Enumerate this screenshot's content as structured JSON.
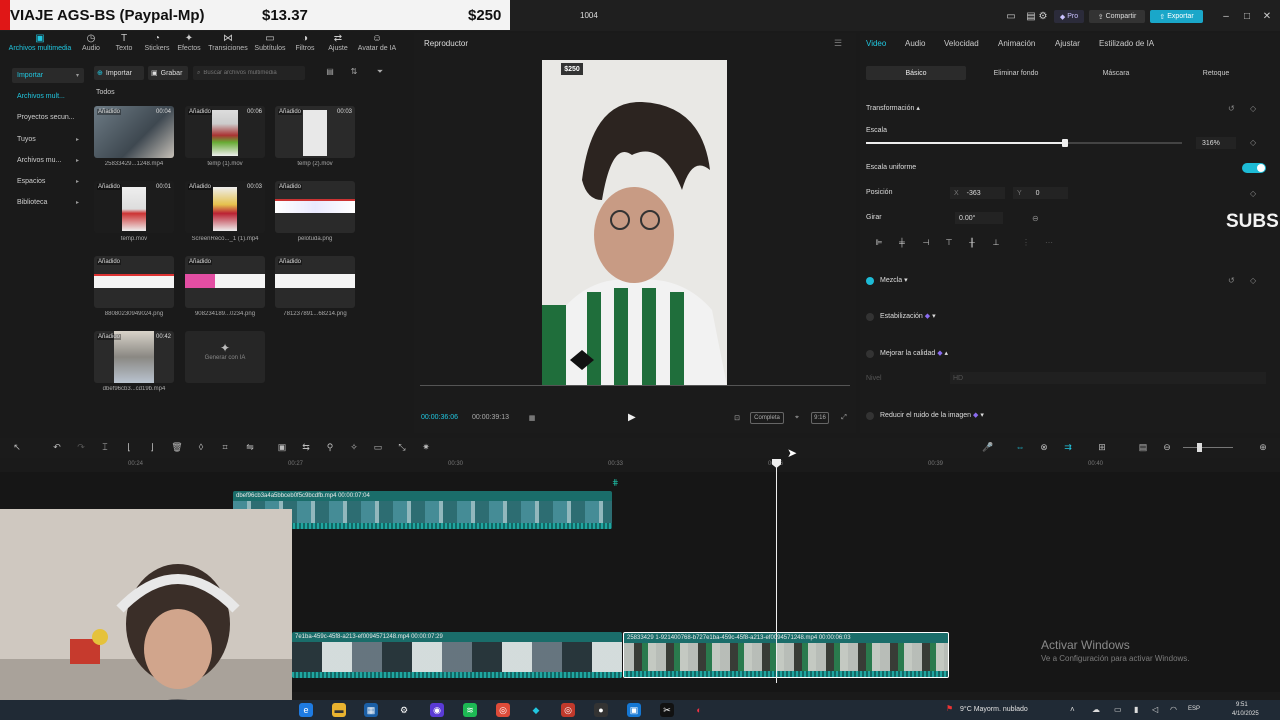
{
  "banner": {
    "title": "VIAJE AGS-BS (Paypal-Mp)",
    "price1": "$13.37",
    "price2": "$250"
  },
  "window": {
    "project": "1004",
    "pro": "Pro",
    "share": "Compartir",
    "export": "Exportar"
  },
  "toolbar": [
    {
      "label": "Archivos multimedia",
      "icon": "media-icon"
    },
    {
      "label": "Audio",
      "icon": "audio-icon"
    },
    {
      "label": "Texto",
      "icon": "text-icon"
    },
    {
      "label": "Stickers",
      "icon": "sticker-icon"
    },
    {
      "label": "Efectos",
      "icon": "effects-icon"
    },
    {
      "label": "Transiciones",
      "icon": "transition-icon"
    },
    {
      "label": "Subtítulos",
      "icon": "subtitles-icon"
    },
    {
      "label": "Filtros",
      "icon": "filter-icon"
    },
    {
      "label": "Ajuste",
      "icon": "adjust-icon"
    },
    {
      "label": "Avatar de IA",
      "icon": "avatar-icon"
    }
  ],
  "nav": [
    {
      "label": "Importar",
      "chev": "▾"
    },
    {
      "label": "Archivos mult...",
      "chev": ""
    },
    {
      "label": "Proyectos secun...",
      "chev": ""
    },
    {
      "label": "Tuyos",
      "chev": "▸"
    },
    {
      "label": "Archivos mu...",
      "chev": "▸"
    },
    {
      "label": "Espacios",
      "chev": "▸"
    },
    {
      "label": "Biblioteca",
      "chev": "▸"
    }
  ],
  "media": {
    "import": "Importar",
    "record": "Grabar",
    "search_placeholder": "Buscar archivos multimedia",
    "filter": "Todos",
    "cards": [
      {
        "badge": "Añadido",
        "dur": "00:04",
        "name": "25833429...1248.mp4"
      },
      {
        "badge": "Añadido",
        "dur": "00:06",
        "name": "temp (1).mov"
      },
      {
        "badge": "Añadido",
        "dur": "00:03",
        "name": "temp (2).mov"
      },
      {
        "badge": "Añadido",
        "dur": "00:01",
        "name": "temp.mov"
      },
      {
        "badge": "Añadido",
        "dur": "00:03",
        "name": "ScreenReco..._1 (1).mp4"
      },
      {
        "badge": "Añadido",
        "dur": "",
        "name": "pelotuda.png"
      },
      {
        "badge": "Añadido",
        "dur": "",
        "name": "88080230949024.png"
      },
      {
        "badge": "Añadido",
        "dur": "",
        "name": "908234189...0234.png"
      },
      {
        "badge": "Añadido",
        "dur": "",
        "name": "781237891...68214.png"
      },
      {
        "badge": "Añadido",
        "dur": "00:42",
        "name": "dbef96cb3...cd19b.mp4"
      }
    ],
    "generate": "Generar con IA"
  },
  "player": {
    "title": "Reproductor",
    "price": "$250",
    "time_current": "00:00:36:06",
    "time_total": "00:00:39:13",
    "full": "Completa",
    "ratio": "9:16"
  },
  "inspector": {
    "tabs": [
      "Video",
      "Audio",
      "Velocidad",
      "Animación",
      "Ajustar",
      "Estilizado de IA"
    ],
    "subtabs": [
      "Básico",
      "Eliminar fondo",
      "Máscara",
      "Retoque"
    ],
    "transform": "Transformación",
    "scale_label": "Escala",
    "scale_value": "316%",
    "scale_fraction": 0.63,
    "uniform": "Escala uniforme",
    "position": "Posición",
    "pos_x_label": "X",
    "pos_x": "-363",
    "pos_y_label": "Y",
    "pos_y": "0",
    "rotate": "Girar",
    "rotate_value": "0.00°",
    "blend": "Mezcla",
    "stabilize": "Estabilización",
    "enhance": "Mejorar la calidad",
    "level": "Nivel",
    "level_value": "HD",
    "noise": "Reducir el ruido de la imagen",
    "overlay_text": "SUBS"
  },
  "timeline": {
    "ticks": [
      "00:24",
      "00:27",
      "00:30",
      "00:33",
      "00:36",
      "00:39",
      "00:40"
    ],
    "clip_upper": "dbef96cb3a4a5bbceb0f5c9bcdfb.mp4   00:00:07:04",
    "clip_lower_a": "7e1ba-459c-45f8-a213-ef0094571248.mp4   00:00:07:29",
    "clip_lower_b": "25833429 1-921400768-b727e1ba-459c-45f8-a213-ef0094571248.mp4   00:00:06:03"
  },
  "activate": {
    "title": "Activar Windows",
    "sub": "Ve a Configuración para activar Windows."
  },
  "taskbar": {
    "weather": "9°C  Mayorm. nublado",
    "lang": "ESP",
    "time": "9:51",
    "date": "4/10/2025"
  }
}
